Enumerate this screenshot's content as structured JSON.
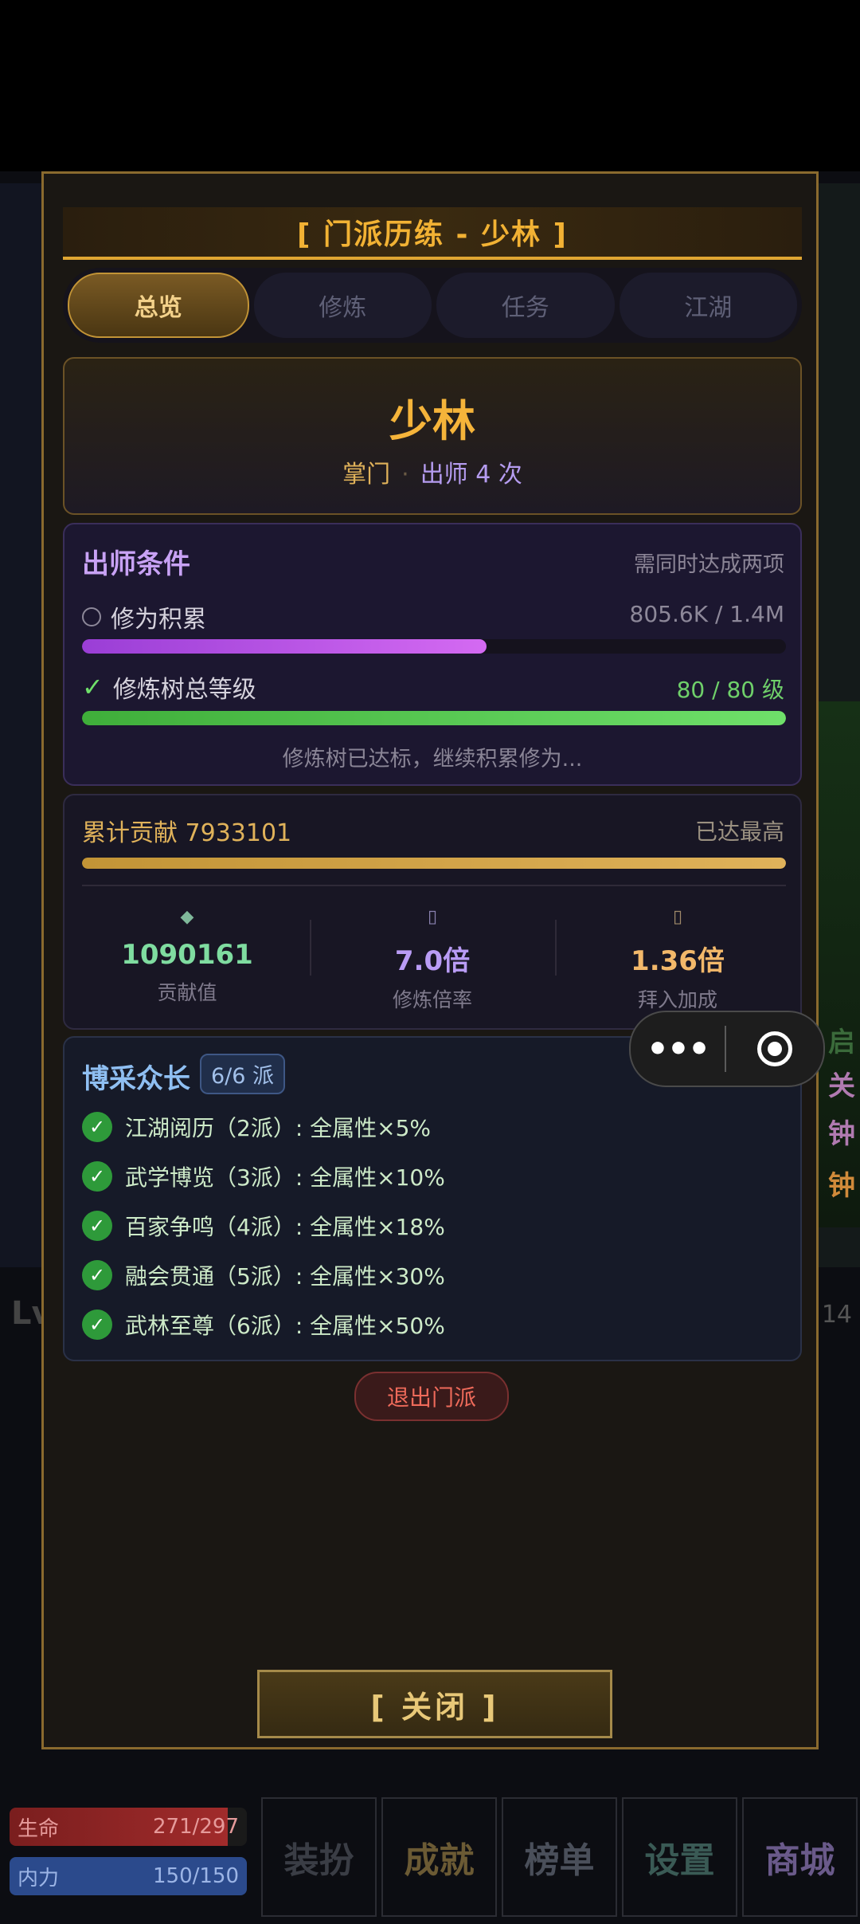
{
  "modal": {
    "title": "[ 门派历练 - 少林 ]",
    "tabs": [
      {
        "label": "总览",
        "active": true
      },
      {
        "label": "修炼",
        "active": false
      },
      {
        "label": "任务",
        "active": false
      },
      {
        "label": "江湖",
        "active": false
      }
    ],
    "sect": {
      "name": "少林",
      "rank": "掌门",
      "separator": "·",
      "graduations": "出师 4 次"
    },
    "conditions": {
      "title": "出师条件",
      "note": "需同时达成两项",
      "items": [
        {
          "label": "修为积累",
          "value": "805.6K / 1.4M",
          "met": false,
          "progress": 0.575
        },
        {
          "label": "修炼树总等级",
          "value": "80 / 80 级",
          "met": true,
          "progress": 1.0
        }
      ],
      "footer": "修炼树已达标，继续积累修为..."
    },
    "contribution": {
      "label": "累计贡献 7933101",
      "status": "已达最高",
      "progress": 1.0,
      "stats": [
        {
          "icon": "◆",
          "value": "1090161",
          "label": "贡献值",
          "color": "#7fdca0"
        },
        {
          "icon": "▯",
          "value": "7.0倍",
          "label": "修炼倍率",
          "color": "#b99cf5"
        },
        {
          "icon": "▯",
          "value": "1.36倍",
          "label": "拜入加成",
          "color": "#f2b86a"
        }
      ]
    },
    "bocai": {
      "title": "博采众长",
      "badge": "6/6 派",
      "bonuses": [
        "江湖阅历（2派）: 全属性×5%",
        "武学博览（3派）: 全属性×10%",
        "百家争鸣（4派）: 全属性×18%",
        "融会贯通（5派）: 全属性×30%",
        "武林至尊（6派）: 全属性×50%"
      ]
    },
    "quit_label": "退出门派",
    "close_label": "[ 关闭 ]"
  },
  "capsule": {
    "more": "•••"
  },
  "background": {
    "hp": {
      "label": "生命",
      "value": "271/297"
    },
    "mp": {
      "label": "内力",
      "value": "150/150"
    },
    "lv": "Lv",
    "side_num": "14",
    "bottom_menu": [
      {
        "label": "装扮",
        "color": "#3a3d45"
      },
      {
        "label": "成就",
        "color": "#6b5a34"
      },
      {
        "label": "榜单",
        "color": "#4a4f5a"
      },
      {
        "label": "设置",
        "color": "#3a5a55"
      },
      {
        "label": "商城",
        "color": "#6a5a8a"
      }
    ],
    "right_texts": [
      {
        "text": "启",
        "color": "#3a6a3a"
      },
      {
        "text": "关",
        "color": "#b07ab0"
      },
      {
        "text": "钟",
        "color": "#b07ab0"
      },
      {
        "text": "钟",
        "color": "#d08a3a"
      }
    ]
  }
}
